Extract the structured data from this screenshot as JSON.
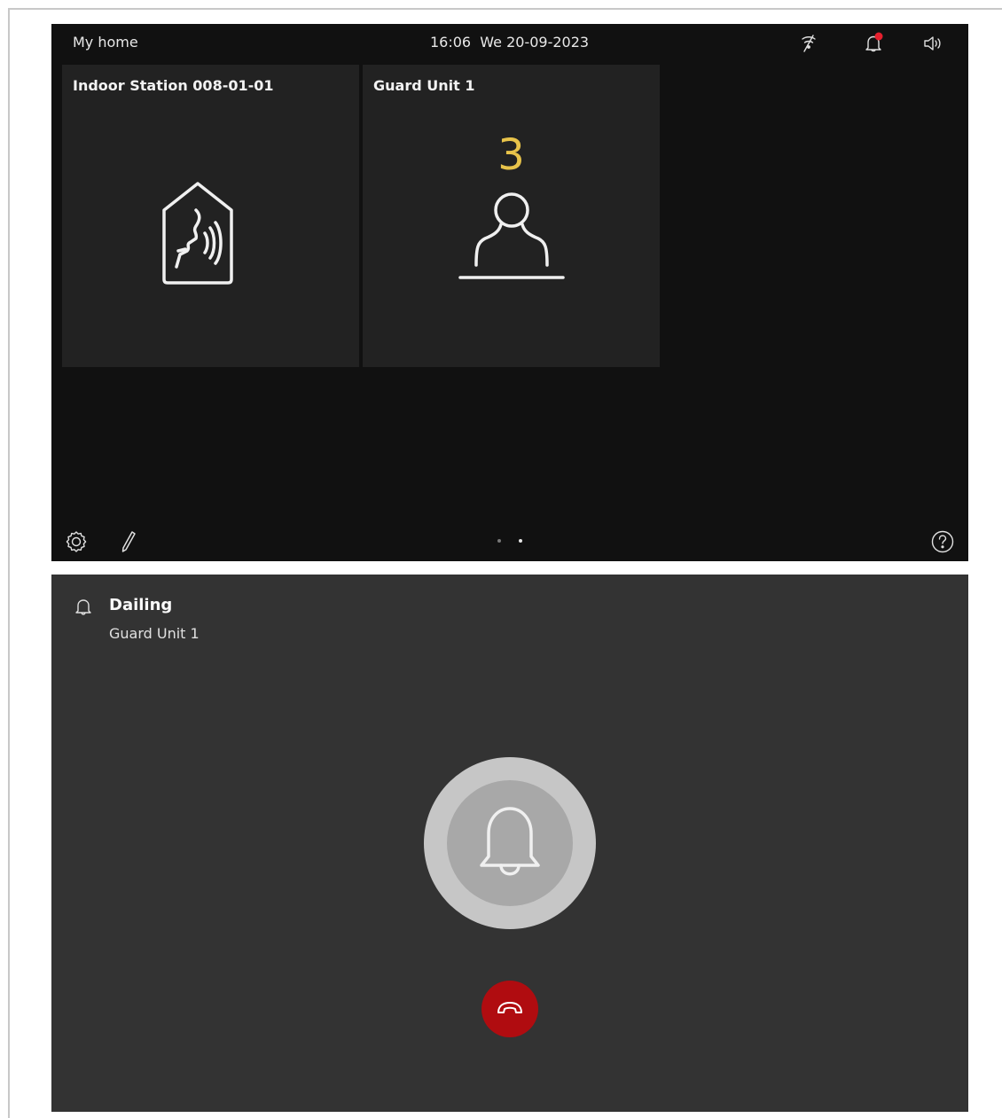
{
  "home_screen": {
    "title": "My home",
    "datetime": "16:06  We 20-09-2023",
    "status_icons": [
      "mute-icon",
      "notification-bell-icon",
      "volume-icon"
    ],
    "notification_dot_color": "#e5202e",
    "tiles": [
      {
        "title": "Indoor Station 008-01-01",
        "icon": "indoor-station-intercom-icon"
      },
      {
        "title": "Guard Unit 1",
        "count": "3",
        "icon": "guard-person-icon"
      }
    ],
    "bottom_icons": [
      "settings-icon",
      "edit-icon",
      "help-icon"
    ],
    "page_indicator": {
      "pages": 2,
      "active": 2
    }
  },
  "dialing_screen": {
    "title": "Dailing",
    "subtitle": "Guard Unit 1",
    "icon": "bell-icon",
    "hangup_color": "#b00c10"
  },
  "colors": {
    "home_background": "#111111",
    "tile_background": "#222222",
    "count_color": "#e8c34a",
    "dialing_background": "#333333"
  }
}
